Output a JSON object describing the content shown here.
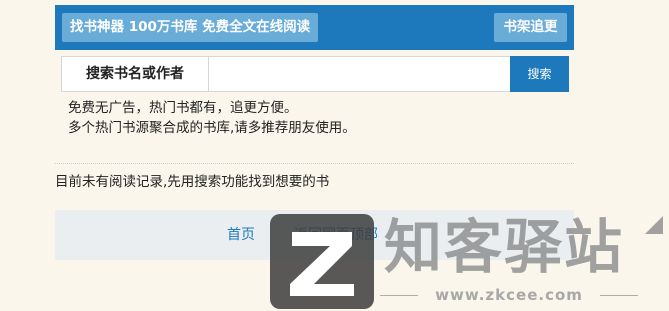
{
  "header": {
    "brand_label": "找书神器 100万书库 免费全文在线阅读",
    "shelf_label": "书架追更",
    "colors": {
      "bar": "#1e79bc",
      "button": "#69acd8"
    }
  },
  "search": {
    "label": "搜索书名或作者",
    "value": "",
    "button_label": "搜索"
  },
  "intro": {
    "line1": "免费无广告，热门书都有，追更方便。",
    "line2": "多个热门书源聚合成的书库,请多推荐朋友使用。"
  },
  "history": {
    "empty_text": "目前未有阅读记录,先用搜索功能找到想要的书"
  },
  "footer": {
    "home_label": "首页",
    "top_label": "返回网页顶部"
  },
  "watermark": {
    "title": "知客驿站",
    "url": "www.zkcee.com",
    "icon": "z-logo-icon"
  }
}
